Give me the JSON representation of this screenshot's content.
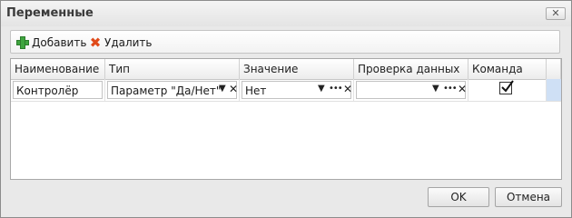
{
  "window": {
    "title": "Переменные",
    "close_glyph": "✕"
  },
  "toolbar": {
    "add_label": "Добавить",
    "delete_label": "Удалить",
    "add_icon": "plus-icon",
    "delete_icon": "x-icon"
  },
  "grid": {
    "columns": [
      "Наименование",
      "Тип",
      "Значение",
      "Проверка данных",
      "Команда"
    ],
    "rows": [
      {
        "name": "Контролёр",
        "type": "Параметр \"Да/Нет\"",
        "value": "Нет",
        "validation": "",
        "command_checked": true
      }
    ]
  },
  "footer": {
    "ok_label": "OK",
    "cancel_label": "Отмена"
  },
  "colors": {
    "add_icon": "#3fa53f",
    "delete_icon": "#e04a1a",
    "row_selector": "#cfe0f5"
  }
}
